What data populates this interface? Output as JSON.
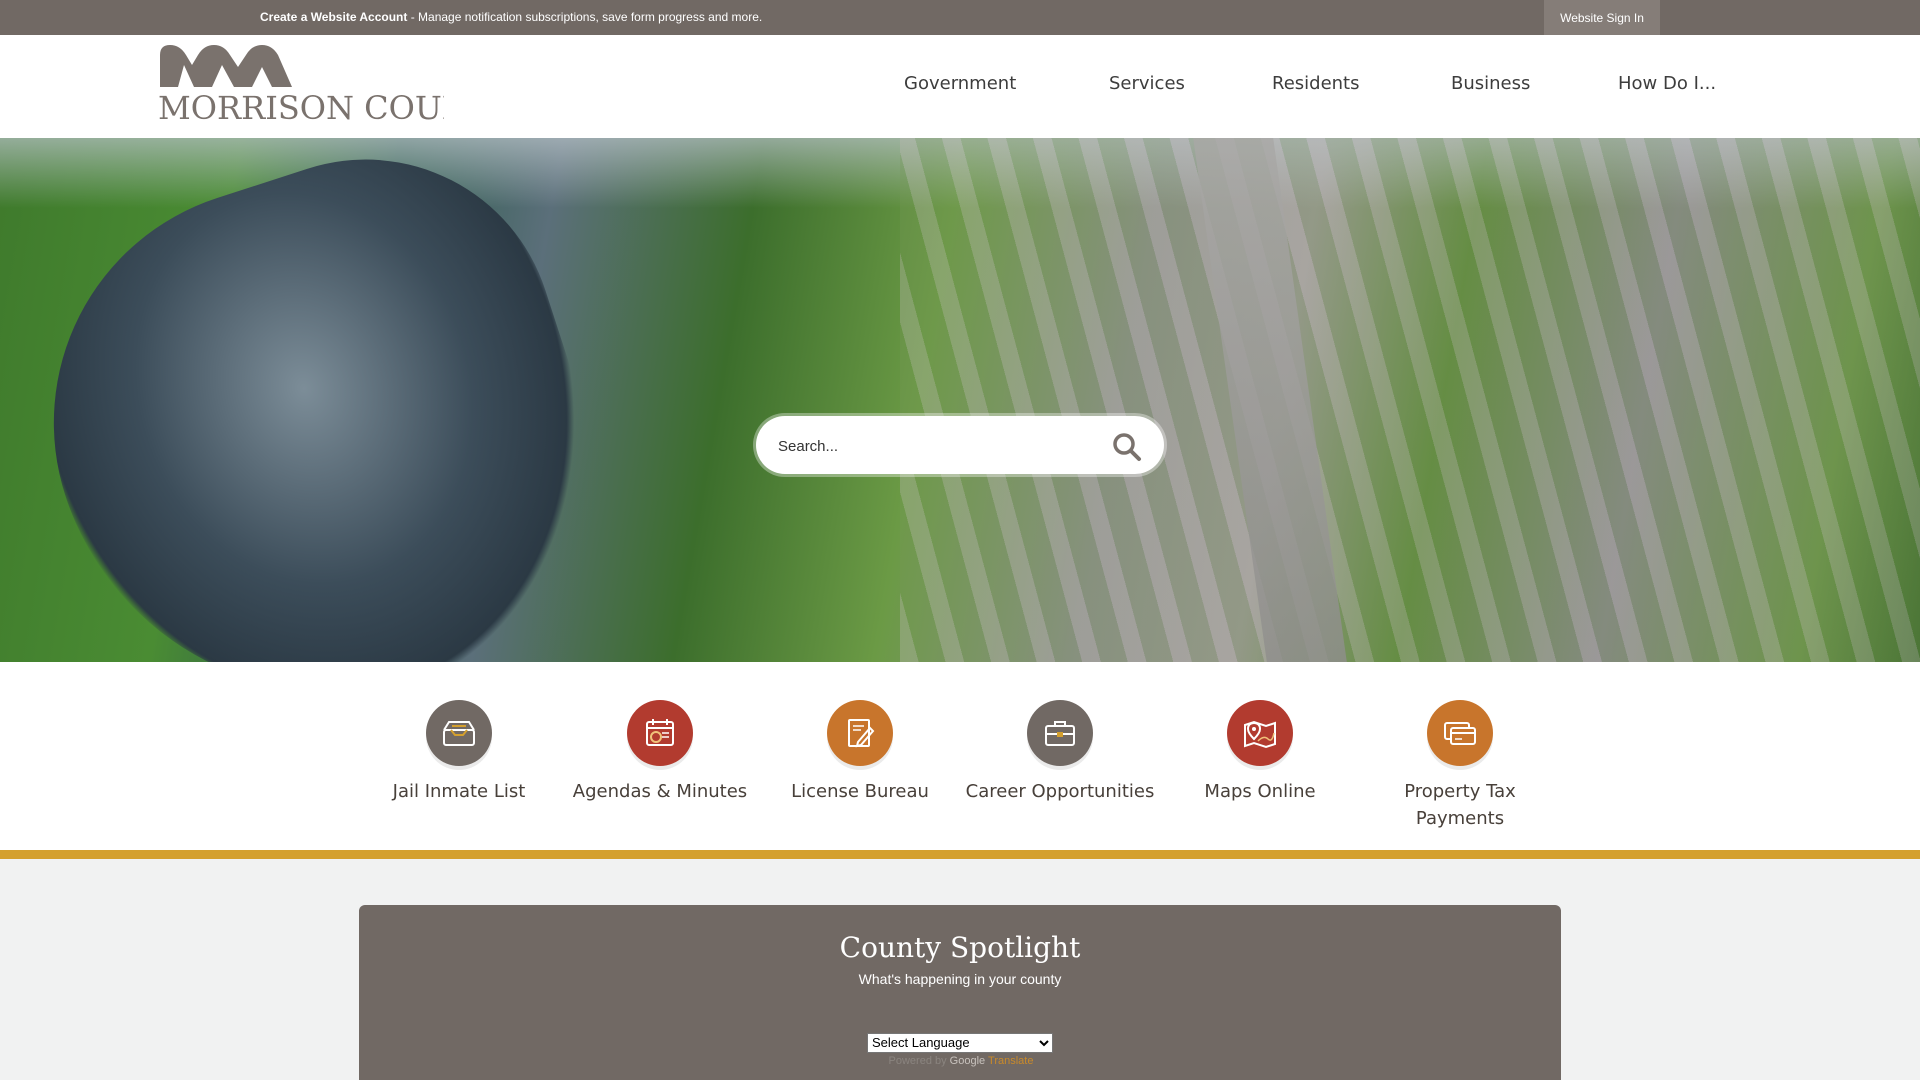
{
  "topbar": {
    "account_bold": "Create a Website Account",
    "account_rest": " - Manage notification subscriptions, save form progress and more.",
    "sign_in": "Website Sign In"
  },
  "logo": {
    "text": "MORRISON COUNTY"
  },
  "nav": [
    {
      "label": "Government"
    },
    {
      "label": "Services"
    },
    {
      "label": "Residents"
    },
    {
      "label": "Business"
    },
    {
      "label": "How Do I..."
    }
  ],
  "search": {
    "placeholder": "Search..."
  },
  "quick_links": [
    {
      "label": "Jail Inmate List",
      "icon": "inbox-tray-icon",
      "color": "#716964"
    },
    {
      "label": "Agendas & Minutes",
      "icon": "calendar-clock-icon",
      "color": "#b23b2f"
    },
    {
      "label": "License Bureau",
      "icon": "document-pen-icon",
      "color": "#c8752c"
    },
    {
      "label": "Career Opportunities",
      "icon": "briefcase-icon",
      "color": "#716964"
    },
    {
      "label": "Maps Online",
      "icon": "map-pin-icon",
      "color": "#b23b2f"
    },
    {
      "label": "Property Tax Payments",
      "icon": "credit-card-icon",
      "color": "#c8752c"
    }
  ],
  "spotlight": {
    "title": "County Spotlight",
    "subtitle": "What's happening in your county"
  },
  "translate": {
    "select_label": "Select Language",
    "powered_by": "Powered by",
    "google": "Google",
    "translate": "Translate"
  },
  "colors": {
    "topbar": "#716964",
    "accent_gold": "#d4a02e",
    "red": "#b23b2f",
    "orange": "#c8752c",
    "taupe": "#716964"
  }
}
